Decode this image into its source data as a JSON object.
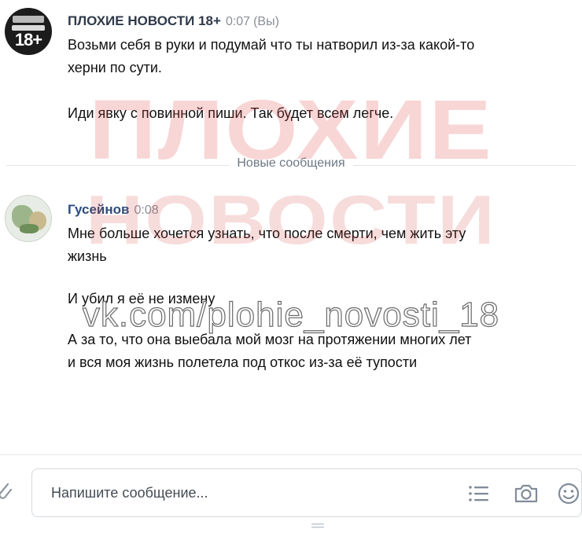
{
  "messages": [
    {
      "author": "ПЛОХИЕ НОВОСТИ 18+",
      "time": "0:07",
      "self_tag": "(Вы)",
      "avatar_text": "18+",
      "lines": [
        "Возьми себя в руки и подумай что ты натворил из-за какой-то",
        "херни по сути.",
        "Иди явку с повинной пиши. Так будет всем легче."
      ]
    },
    {
      "author": "Гусейнов",
      "time": "0:08",
      "lines": [
        "Мне больше хочется узнать, что после смерти, чем жить эту",
        "жизнь",
        "И убил я её не измену",
        "А за то, что она выебала мой мозг на протяжении многих лет",
        "и вся моя жизнь полетела под откос из-за её тупости"
      ]
    }
  ],
  "divider": {
    "label": "Новые сообщения"
  },
  "watermark": {
    "line1": "ПЛОХИЕ",
    "line2": "НОВОСТИ",
    "url": "vk.com/plohie_novosti_18"
  },
  "composer": {
    "placeholder": "Напишите сообщение..."
  },
  "icons": {
    "attach": "paperclip-icon",
    "templates": "list-icon",
    "camera": "camera-icon",
    "emoji": "smile-icon"
  }
}
